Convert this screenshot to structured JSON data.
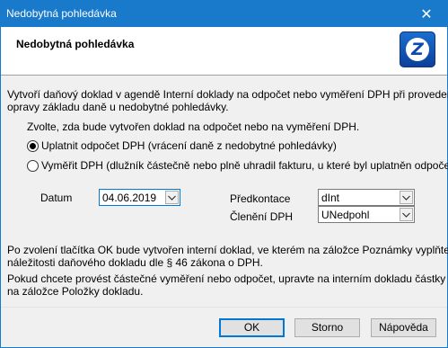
{
  "window": {
    "title": "Nedobytná pohledávka",
    "close_symbol": "✕"
  },
  "header": {
    "title": "Nedobytná pohledávka",
    "logo_icon": "z-logo-icon"
  },
  "intro": {
    "line1": "Vytvoří daňový doklad v agendě Interní doklady na odpočet nebo vyměření DPH při provedení",
    "line2": "opravy základu daně u nedobytné pohledávky."
  },
  "choose_text": "Zvolte, zda bude vytvořen doklad na odpočet nebo na vyměření DPH.",
  "options": [
    {
      "label": "Uplatnit odpočet DPH (vrácení daně z nedobytné pohledávky)",
      "selected": true
    },
    {
      "label": "Vyměřit DPH (dlužník částečně nebo plně uhradil fakturu, u které byl uplatněn odpočet)",
      "selected": false
    }
  ],
  "fields": {
    "date_label": "Datum",
    "date_value": "04.06.2019",
    "predkontace_label": "Předkontace",
    "predkontace_value": "dInt",
    "cleneni_label": "Členění DPH",
    "cleneni_value": "UNedpohl"
  },
  "info": {
    "p1_line1": "Po zvolení tlačítka OK bude vytvořen interní doklad, ve kterém na záložce Poznámky vyplňte",
    "p1_line2": "náležitosti daňového dokladu dle § 46 zákona o DPH.",
    "p2_line1": "Pokud chcete provést částečné vyměření nebo odpočet, upravte na interním dokladu částky",
    "p2_line2": "na záložce Položky dokladu."
  },
  "buttons": {
    "ok": "OK",
    "cancel": "Storno",
    "help": "Nápověda"
  },
  "colors": {
    "titlebar": "#1979ca",
    "accent": "#0078d7"
  }
}
